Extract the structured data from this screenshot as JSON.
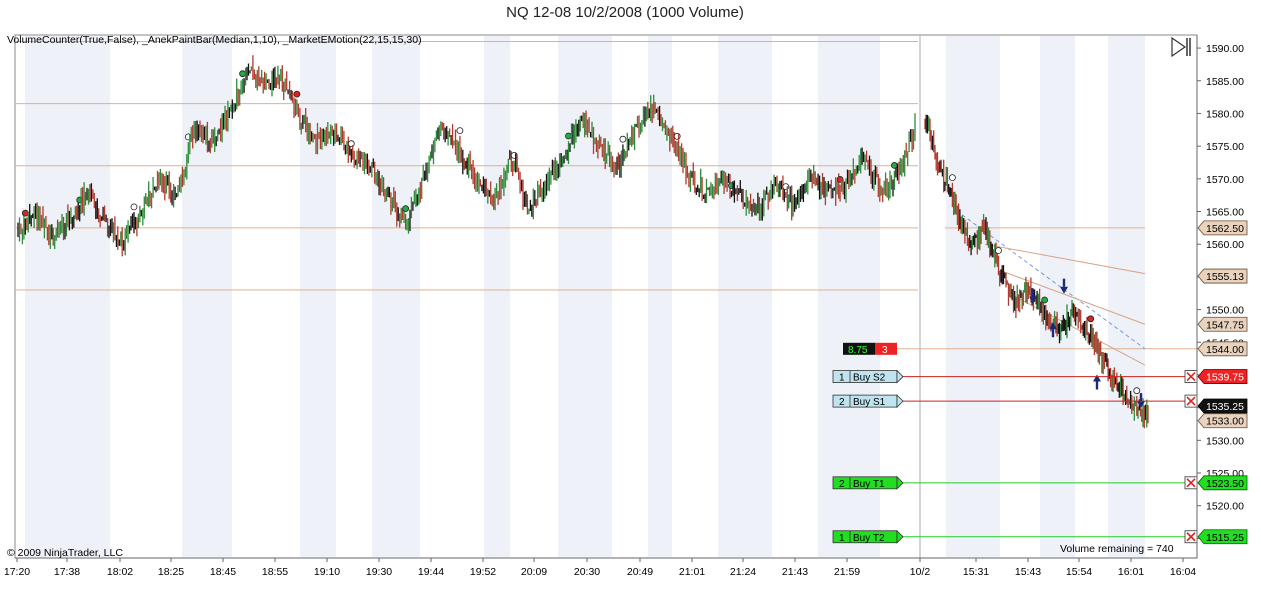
{
  "window": {
    "title": "NQ 12-08  10/2/2008 (1000 Volume)"
  },
  "chart": {
    "indicators_label": "VolumeCounter(True,False),  _AnekPaintBar(Median,1,10),  _MarketEMotion(22,15,15,30)",
    "copyright": "© 2009 NinjaTrader, LLC",
    "volume_remaining": "Volume remaining = 740",
    "play_icon": "play-pause-icon"
  },
  "colors": {
    "up_bar": "#2e8b3a",
    "down_bar": "#b03a2e",
    "neutral_bar": "#111111",
    "level_line": "#e0b090",
    "stop_line": "#cc2222",
    "target_line": "#22cc22",
    "trend_line": "#7799dd",
    "session_shade": "#eef1f8"
  },
  "chart_data": {
    "type": "bar",
    "instrument": "NQ 12-08",
    "y_ticks": [
      "1590.00",
      "1585.00",
      "1580.00",
      "1575.00",
      "1570.00",
      "1565.00",
      "1560.00",
      "1555.00",
      "1550.00",
      "1545.00",
      "1540.00",
      "1535.00",
      "1530.00",
      "1525.00",
      "1520.00",
      "1515.00"
    ],
    "ylim": [
      1512,
      1592
    ],
    "x_ticks": [
      "17:20",
      "17:38",
      "18:02",
      "18:25",
      "18:45",
      "18:55",
      "19:10",
      "19:30",
      "19:44",
      "19:52",
      "20:09",
      "20:30",
      "20:49",
      "21:01",
      "21:24",
      "21:43",
      "21:59",
      "10/2",
      "15:31",
      "15:43",
      "15:54",
      "16:01",
      "16:04"
    ],
    "close_path": [
      1562,
      1565,
      1561,
      1564,
      1568,
      1563,
      1560,
      1565,
      1570,
      1567,
      1578,
      1576,
      1580,
      1587,
      1584,
      1585,
      1579,
      1576,
      1577,
      1574,
      1572,
      1567,
      1563,
      1570,
      1578,
      1574,
      1570,
      1567,
      1573,
      1565,
      1570,
      1574,
      1579,
      1575,
      1572,
      1577,
      1581,
      1577,
      1571,
      1568,
      1570,
      1567,
      1565,
      1569,
      1566,
      1571,
      1568,
      1569,
      1573,
      1568,
      1571,
      1579,
      1572,
      1566,
      1560,
      1562,
      1556,
      1551,
      1553,
      1549,
      1547,
      1550,
      1546,
      1542,
      1538,
      1535,
      1534
    ],
    "price_levels": [
      {
        "value": 1591.0
      },
      {
        "value": 1581.5
      },
      {
        "value": 1572.0
      },
      {
        "value": 1562.5
      },
      {
        "value": 1553.0
      }
    ],
    "price_labels": [
      {
        "label": "1562.50",
        "value": 1562.5,
        "style": "level"
      },
      {
        "label": "1555.13",
        "value": 1555.13,
        "style": "level"
      },
      {
        "label": "1547.75",
        "value": 1547.75,
        "style": "level"
      },
      {
        "label": "1544.00",
        "value": 1544.0,
        "style": "level"
      },
      {
        "label": "1539.75",
        "value": 1539.75,
        "style": "stop"
      },
      {
        "label": "1535.25",
        "value": 1535.25,
        "style": "last"
      },
      {
        "label": "1533.00",
        "value": 1533.0,
        "style": "level"
      },
      {
        "label": "1523.50",
        "value": 1523.5,
        "style": "target"
      },
      {
        "label": "1515.25",
        "value": 1515.25,
        "style": "target"
      }
    ],
    "orders": [
      {
        "qty": "1",
        "name": "Buy S2",
        "value": 1539.75,
        "kind": "stop"
      },
      {
        "qty": "2",
        "name": "Buy S1",
        "value": 1536.0,
        "kind": "stop"
      },
      {
        "qty": "2",
        "name": "Buy T1",
        "value": 1523.5,
        "kind": "target"
      },
      {
        "qty": "1",
        "name": "Buy T2",
        "value": 1515.25,
        "kind": "target"
      }
    ],
    "position_box": {
      "pnl": "8.75",
      "qty": "3",
      "value": 1544.0
    }
  }
}
